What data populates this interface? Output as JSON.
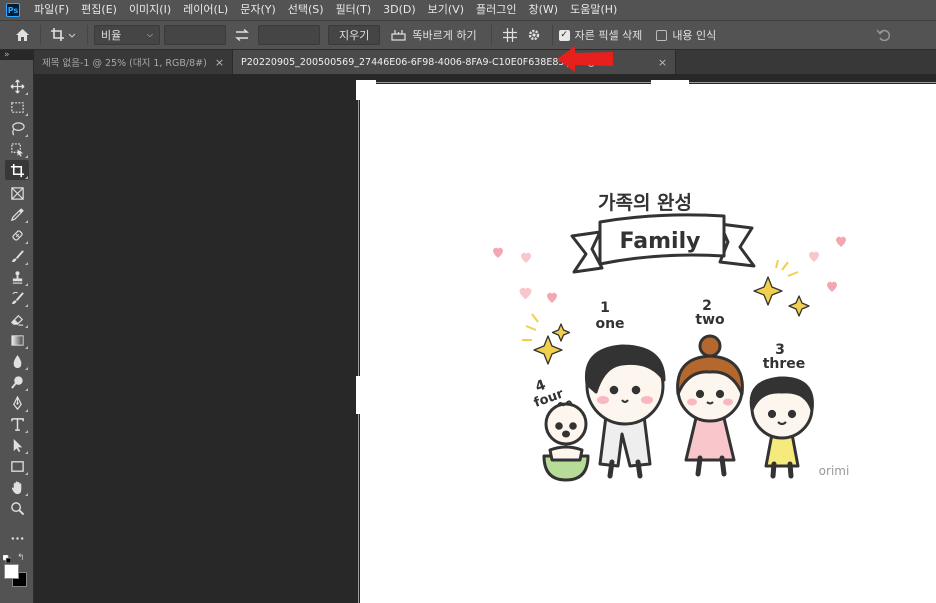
{
  "app": {
    "logo_text": "Ps",
    "menu": [
      "파일(F)",
      "편집(E)",
      "이미지(I)",
      "레이어(L)",
      "문자(Y)",
      "선택(S)",
      "필터(T)",
      "3D(D)",
      "보기(V)",
      "플러그인",
      "창(W)",
      "도움말(H)"
    ]
  },
  "options_bar": {
    "ratio_select": "비율",
    "clear_button": "지우기",
    "straighten_label": "똑바르게 하기",
    "delete_cropped_label": "자른 픽셀 삭제",
    "delete_cropped_checked": true,
    "content_aware_label": "내용 인식",
    "content_aware_checked": false
  },
  "tabs": [
    {
      "label": "제목 없음-1 @ 25% (대지 1, RGB/8#)",
      "active": false
    },
    {
      "label": "P20220905_200500569_27446E06-6F98-4006-8FA9-C10E0F638E85.JPG @",
      "active": true
    }
  ],
  "canvas_art": {
    "title": "가족의 완성",
    "banner": "Family",
    "labels": [
      {
        "num": "1",
        "word": "one"
      },
      {
        "num": "2",
        "word": "two"
      },
      {
        "num": "3",
        "word": "three"
      },
      {
        "num": "4",
        "word": "four"
      }
    ],
    "signature": "orimi"
  },
  "colors": {
    "foreground": "#ffffff",
    "background": "#000000",
    "annotation_arrow": "#e8201d"
  }
}
